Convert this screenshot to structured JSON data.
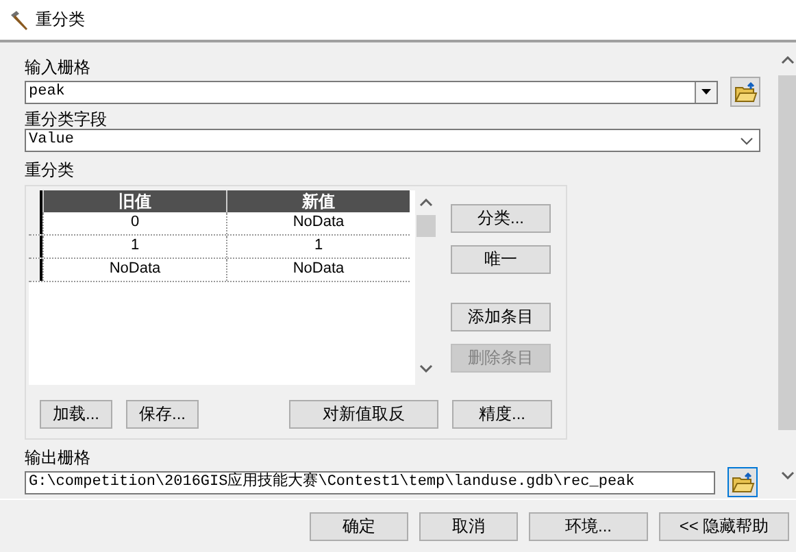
{
  "window": {
    "title": "重分类"
  },
  "input_raster": {
    "label": "输入栅格",
    "value": "peak"
  },
  "reclass_field": {
    "label": "重分类字段",
    "value": "Value"
  },
  "reclass": {
    "label": "重分类",
    "columns": [
      "旧值",
      "新值"
    ],
    "rows": [
      {
        "old": "0",
        "new": "NoData"
      },
      {
        "old": "1",
        "new": "1"
      },
      {
        "old": "NoData",
        "new": "NoData"
      }
    ],
    "side_buttons": [
      {
        "label": "分类...",
        "disabled": false
      },
      {
        "label": "唯一",
        "disabled": false
      },
      {
        "label": "添加条目",
        "disabled": false
      },
      {
        "label": "删除条目",
        "disabled": true
      }
    ],
    "bottom_buttons": [
      "加载...",
      "保存...",
      "对新值取反",
      "精度..."
    ]
  },
  "output_raster": {
    "label": "输出栅格",
    "value": "G:\\competition\\2016GIS应用技能大赛\\Contest1\\temp\\landuse.gdb\\rec_peak"
  },
  "buttons": [
    "确定",
    "取消",
    "环境...",
    "<< 隐藏帮助"
  ]
}
